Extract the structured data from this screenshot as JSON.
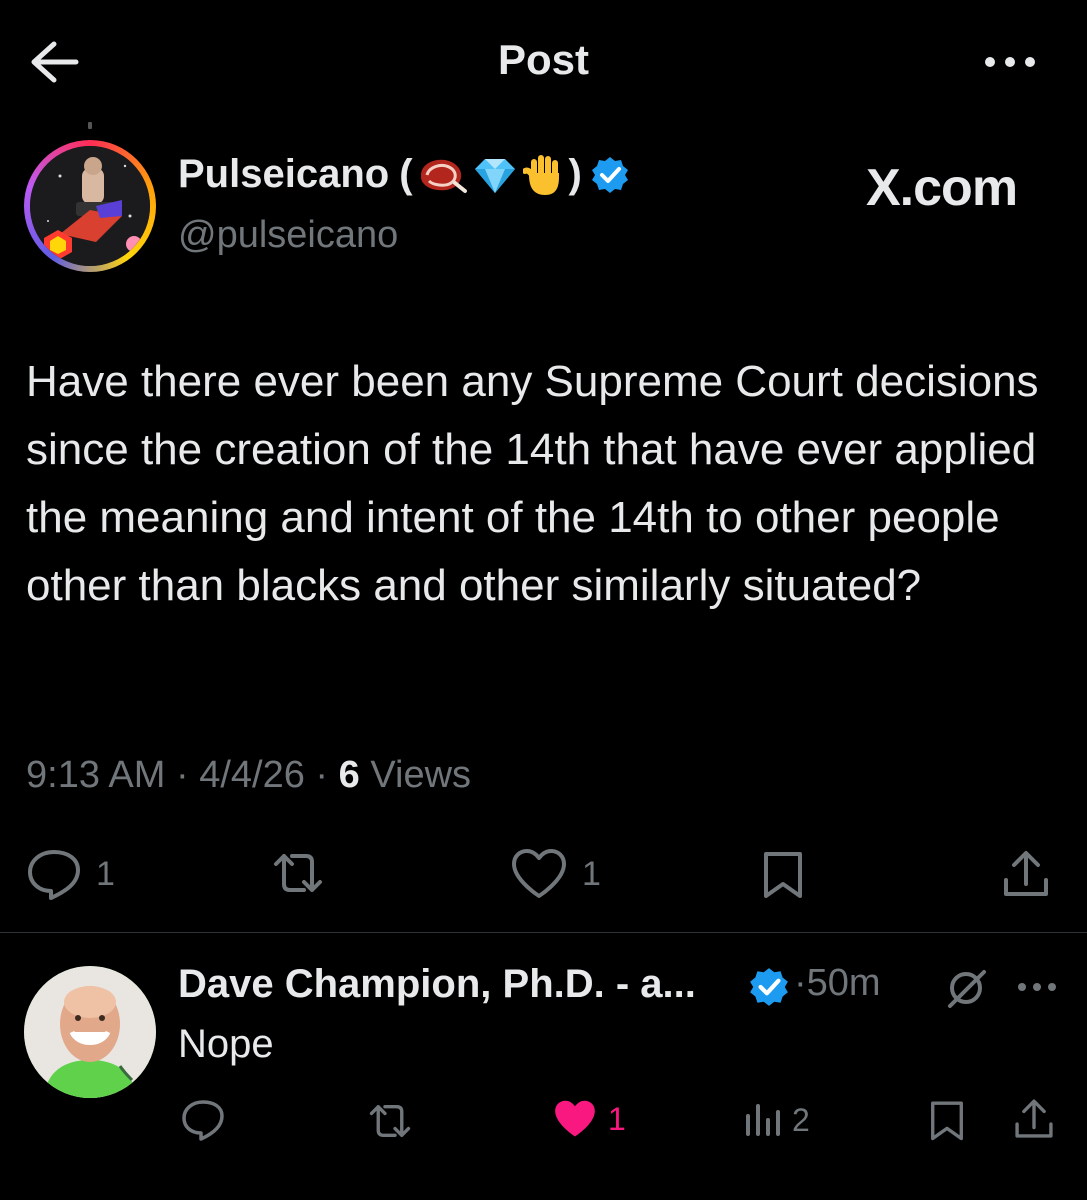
{
  "header": {
    "title": "Post",
    "back_icon": "arrow-left-icon",
    "more_icon": "more-horizontal-icon"
  },
  "post": {
    "author": {
      "name": "Pulseicano",
      "emoji": [
        "meat-emoji",
        "gem-emoji",
        "raised-hand-emoji"
      ],
      "verified": true,
      "handle": "@pulseicano"
    },
    "watermark": "X.com",
    "text": "Have there ever been any Supreme Court decisions since the creation of the 14th that have ever applied the meaning and intent of the 14th to other people other than blacks and other similarly situated?",
    "time": "9:13 AM",
    "date": "4/4/26",
    "views_count": "6",
    "views_label": "Views",
    "actions": {
      "replies": "1",
      "reposts": "",
      "likes": "1"
    }
  },
  "reply": {
    "author_name": "Dave Champion, Ph.D. - a...",
    "verified": true,
    "time": "50m",
    "text": "Nope",
    "actions": {
      "likes": "1",
      "views": "2"
    },
    "like_active": true
  },
  "colors": {
    "background": "#000000",
    "text_primary": "#e7e9ea",
    "text_secondary": "#71767b",
    "verified_blue": "#1d9bf0",
    "like_pink": "#f91880",
    "divider": "#2f3336"
  }
}
